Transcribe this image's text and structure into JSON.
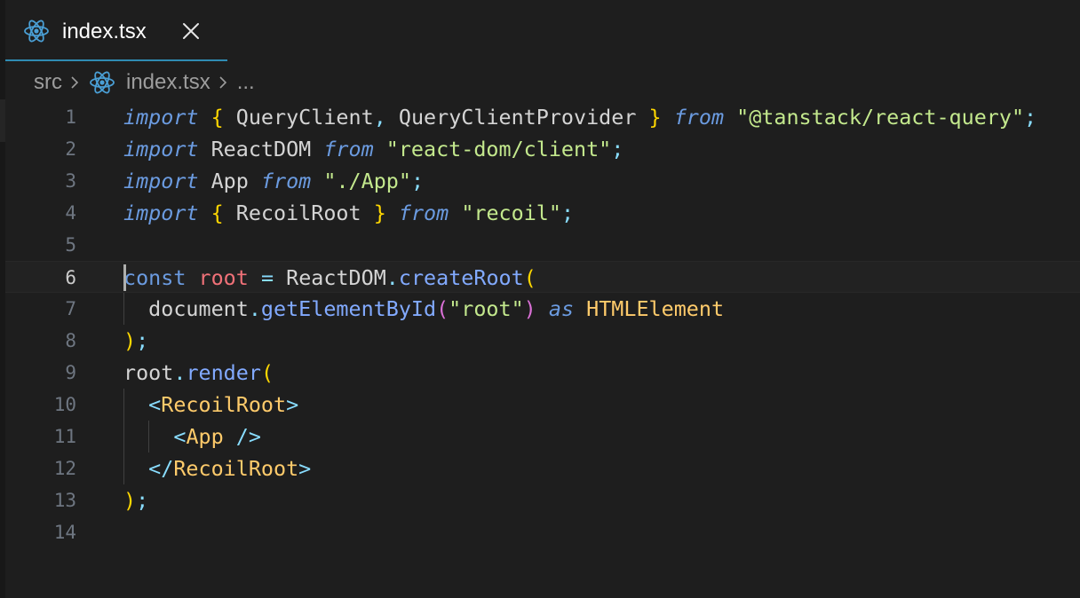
{
  "tab": {
    "label": "index.tsx",
    "icon": "react-icon",
    "close_icon": "close-icon"
  },
  "breadcrumb": [
    "src",
    "index.tsx",
    "..."
  ],
  "editor": {
    "active_line": 6,
    "lines": [
      {
        "n": "1",
        "tokens": [
          [
            "import",
            "kw-i"
          ],
          [
            " ",
            "ident"
          ],
          [
            "{",
            "brace"
          ],
          [
            " QueryClient",
            "ident"
          ],
          [
            ",",
            "punct"
          ],
          [
            " QueryClientProvider ",
            "ident"
          ],
          [
            "}",
            "brace"
          ],
          [
            " ",
            "ident"
          ],
          [
            "from",
            "kw-i"
          ],
          [
            " ",
            "ident"
          ],
          [
            "\"@tanstack/react-query\"",
            "str"
          ],
          [
            ";",
            "punct"
          ]
        ]
      },
      {
        "n": "2",
        "tokens": [
          [
            "import",
            "kw-i"
          ],
          [
            " ReactDOM ",
            "ident"
          ],
          [
            "from",
            "kw-i"
          ],
          [
            " ",
            "ident"
          ],
          [
            "\"react-dom/client\"",
            "str"
          ],
          [
            ";",
            "punct"
          ]
        ]
      },
      {
        "n": "3",
        "tokens": [
          [
            "import",
            "kw-i"
          ],
          [
            " App ",
            "ident"
          ],
          [
            "from",
            "kw-i"
          ],
          [
            " ",
            "ident"
          ],
          [
            "\"./App\"",
            "str"
          ],
          [
            ";",
            "punct"
          ]
        ]
      },
      {
        "n": "4",
        "tokens": [
          [
            "import",
            "kw-i"
          ],
          [
            " ",
            "ident"
          ],
          [
            "{",
            "brace"
          ],
          [
            " RecoilRoot ",
            "ident"
          ],
          [
            "}",
            "brace"
          ],
          [
            " ",
            "ident"
          ],
          [
            "from",
            "kw-i"
          ],
          [
            " ",
            "ident"
          ],
          [
            "\"recoil\"",
            "str"
          ],
          [
            ";",
            "punct"
          ]
        ]
      },
      {
        "n": "5",
        "tokens": []
      },
      {
        "n": "6",
        "tokens": [
          [
            "const",
            "kw"
          ],
          [
            " ",
            "ident"
          ],
          [
            "root",
            "var"
          ],
          [
            " ",
            "ident"
          ],
          [
            "=",
            "punct"
          ],
          [
            " ReactDOM",
            "ident"
          ],
          [
            ".",
            "punct"
          ],
          [
            "createRoot",
            "fn"
          ],
          [
            "(",
            "paren-y"
          ]
        ]
      },
      {
        "n": "7",
        "tokens": [
          [
            "  document",
            "ident"
          ],
          [
            ".",
            "punct"
          ],
          [
            "getElementById",
            "fn"
          ],
          [
            "(",
            "paren-p"
          ],
          [
            "\"root\"",
            "str"
          ],
          [
            ")",
            "paren-p"
          ],
          [
            " ",
            "ident"
          ],
          [
            "as",
            "kw-i"
          ],
          [
            " ",
            "ident"
          ],
          [
            "HTMLElement",
            "type"
          ]
        ]
      },
      {
        "n": "8",
        "tokens": [
          [
            ")",
            "paren-y"
          ],
          [
            ";",
            "punct"
          ]
        ]
      },
      {
        "n": "9",
        "tokens": [
          [
            "root",
            "ident"
          ],
          [
            ".",
            "punct"
          ],
          [
            "render",
            "fn"
          ],
          [
            "(",
            "paren-y"
          ]
        ]
      },
      {
        "n": "10",
        "tokens": [
          [
            "  ",
            "ident"
          ],
          [
            "<",
            "punct"
          ],
          [
            "RecoilRoot",
            "tag"
          ],
          [
            ">",
            "punct"
          ]
        ]
      },
      {
        "n": "11",
        "tokens": [
          [
            "    ",
            "ident"
          ],
          [
            "<",
            "punct"
          ],
          [
            "App",
            "tag"
          ],
          [
            " ",
            "ident"
          ],
          [
            "/>",
            "punct"
          ]
        ]
      },
      {
        "n": "12",
        "tokens": [
          [
            "  ",
            "ident"
          ],
          [
            "</",
            "punct"
          ],
          [
            "RecoilRoot",
            "tag"
          ],
          [
            ">",
            "punct"
          ]
        ]
      },
      {
        "n": "13",
        "tokens": [
          [
            ")",
            "paren-y"
          ],
          [
            ";",
            "punct"
          ]
        ]
      },
      {
        "n": "14",
        "tokens": []
      }
    ]
  },
  "colors": {
    "accent": "#2f8bb3",
    "react_icon": "#4a9fd5",
    "background": "#1e1e1e"
  }
}
